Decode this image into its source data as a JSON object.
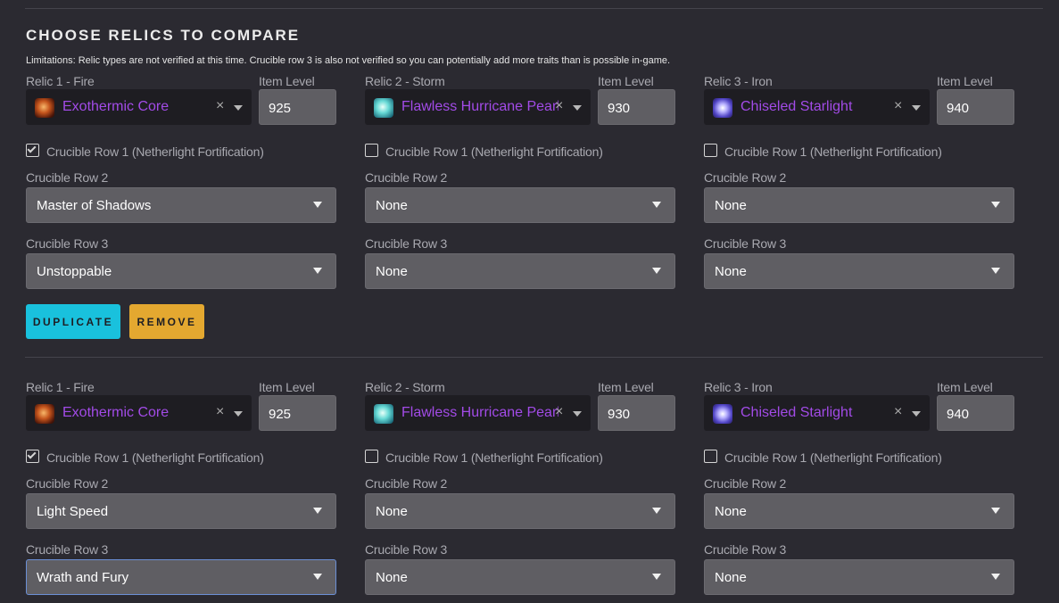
{
  "header": {
    "title": "CHOOSE RELICS TO COMPARE",
    "limitations": "Limitations: Relic types are not verified at this time. Crucible row 3 is also not verified so you can potentially add more traits than is possible in-game."
  },
  "labels": {
    "item_level": "Item Level",
    "crucible_row1": "Crucible Row 1 (Netherlight Fortification)",
    "crucible_row2": "Crucible Row 2",
    "crucible_row3": "Crucible Row 3",
    "clear": "×"
  },
  "buttons": {
    "duplicate": "DUPLICATE",
    "remove": "REMOVE"
  },
  "colors": {
    "relic_name": "#a24be7",
    "duplicate": "#19c1dd",
    "remove": "#e4a830",
    "focus": "#6b8fd6"
  },
  "sets": [
    {
      "relics": [
        {
          "label": "Relic 1 - Fire",
          "name": "Exothermic Core",
          "icon": "fire-relic-icon",
          "item_level": "925",
          "row1_checked": true,
          "row2": "Master of Shadows",
          "row3": "Unstoppable"
        },
        {
          "label": "Relic 2 - Storm",
          "name": "Flawless Hurricane Pearl",
          "icon": "storm-relic-icon",
          "item_level": "930",
          "row1_checked": false,
          "row2": "None",
          "row3": "None"
        },
        {
          "label": "Relic 3 - Iron",
          "name": "Chiseled Starlight",
          "icon": "iron-relic-icon",
          "item_level": "940",
          "row1_checked": false,
          "row2": "None",
          "row3": "None"
        }
      ]
    },
    {
      "relics": [
        {
          "label": "Relic 1 - Fire",
          "name": "Exothermic Core",
          "icon": "fire-relic-icon",
          "item_level": "925",
          "row1_checked": true,
          "row2": "Light Speed",
          "row3": "Wrath and Fury"
        },
        {
          "label": "Relic 2 - Storm",
          "name": "Flawless Hurricane Pearl",
          "icon": "storm-relic-icon",
          "item_level": "930",
          "row1_checked": false,
          "row2": "None",
          "row3": "None"
        },
        {
          "label": "Relic 3 - Iron",
          "name": "Chiseled Starlight",
          "icon": "iron-relic-icon",
          "item_level": "940",
          "row1_checked": false,
          "row2": "None",
          "row3": "None"
        }
      ]
    }
  ]
}
